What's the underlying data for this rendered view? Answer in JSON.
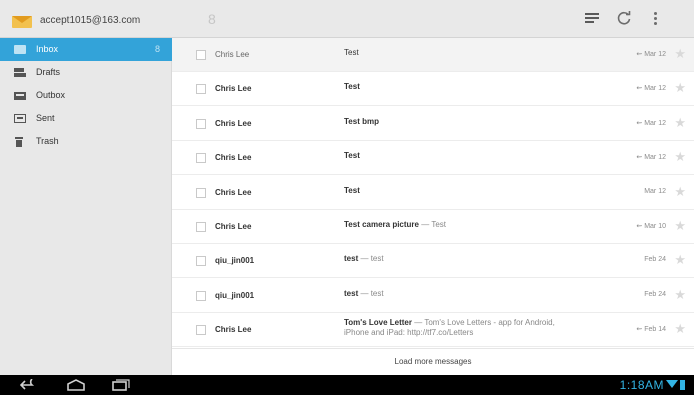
{
  "account": {
    "email": "accept1015@163.com",
    "unread_count": "8"
  },
  "toolbar": {
    "icons": [
      "compose-icon",
      "refresh-icon",
      "overflow-menu-icon"
    ]
  },
  "folders": [
    {
      "label": "Inbox",
      "count": "8",
      "selected": true,
      "icon": "inbox-icon"
    },
    {
      "label": "Drafts",
      "count": "",
      "selected": false,
      "icon": "drafts-icon"
    },
    {
      "label": "Outbox",
      "count": "",
      "selected": false,
      "icon": "outbox-icon"
    },
    {
      "label": "Sent",
      "count": "",
      "selected": false,
      "icon": "sent-icon"
    },
    {
      "label": "Trash",
      "count": "",
      "selected": false,
      "icon": "trash-icon"
    }
  ],
  "messages": [
    {
      "sender": "Chris Lee",
      "subject": "Test",
      "snippet": "",
      "separator": "",
      "snippet2": "",
      "date": "Mar 12",
      "reply_icon": true,
      "read": true
    },
    {
      "sender": "Chris Lee",
      "subject": "Test",
      "snippet": "",
      "separator": "",
      "snippet2": "",
      "date": "Mar 12",
      "reply_icon": true,
      "read": false
    },
    {
      "sender": "Chris Lee",
      "subject": "Test bmp",
      "snippet": "",
      "separator": "",
      "snippet2": "",
      "date": "Mar 12",
      "reply_icon": true,
      "read": false
    },
    {
      "sender": "Chris Lee",
      "subject": "Test",
      "snippet": "",
      "separator": "",
      "snippet2": "",
      "date": "Mar 12",
      "reply_icon": true,
      "read": false
    },
    {
      "sender": "Chris Lee",
      "subject": "Test",
      "snippet": "",
      "separator": "",
      "snippet2": "",
      "date": "Mar 12",
      "reply_icon": false,
      "read": false
    },
    {
      "sender": "Chris Lee",
      "subject": "Test camera picture",
      "snippet": "Test",
      "separator": " — ",
      "snippet2": "",
      "date": "Mar 10",
      "reply_icon": true,
      "read": false
    },
    {
      "sender": "qiu_jin001",
      "subject": "test",
      "snippet": "test",
      "separator": " — ",
      "snippet2": "",
      "date": "Feb 24",
      "reply_icon": false,
      "read": false
    },
    {
      "sender": "qiu_jin001",
      "subject": "test",
      "snippet": "test",
      "separator": " — ",
      "snippet2": "",
      "date": "Feb 24",
      "reply_icon": false,
      "read": false
    },
    {
      "sender": "Chris Lee",
      "subject": "Tom's Love Letter",
      "snippet": "Tom's Love Letters - app for Android,",
      "separator": " — ",
      "snippet2": "iPhone and iPad: http://tf7.co/Letters",
      "date": "Feb 14",
      "reply_icon": true,
      "read": false
    }
  ],
  "reply_glyph": "⇜",
  "star_glyph": "★",
  "load_more": "Load more messages",
  "status_bar": {
    "time": "1:18AM",
    "icons": [
      "wifi-icon",
      "battery-icon"
    ]
  },
  "colors": {
    "accent": "#33a3d9",
    "clock": "#33b5e5"
  }
}
